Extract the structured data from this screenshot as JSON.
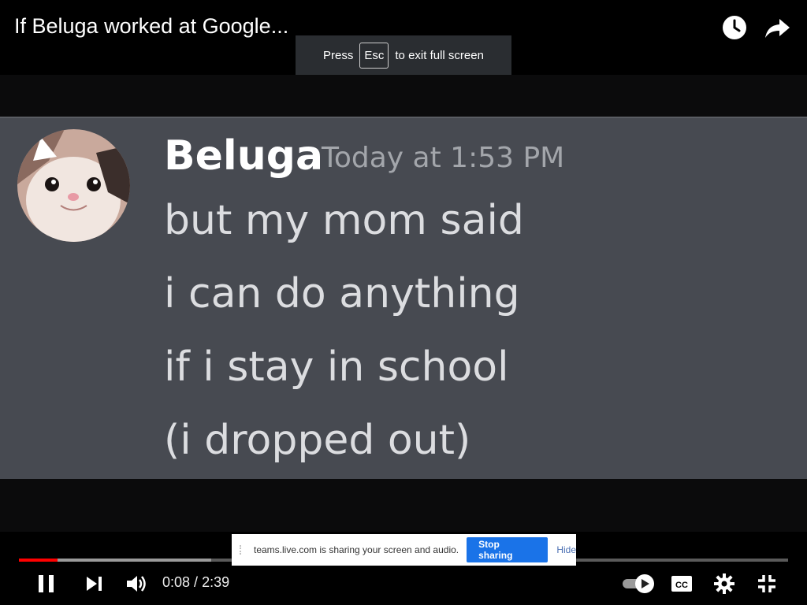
{
  "player": {
    "title": "If Beluga worked at Google...",
    "fullscreen_hint": {
      "before": "Press",
      "key": "Esc",
      "after": "to exit full screen"
    },
    "top_icons": [
      "watch-later-icon",
      "share-icon"
    ],
    "progress": {
      "played_fraction": 0.05,
      "buffered_fraction": 0.25
    },
    "time": {
      "current": "0:08",
      "separator": " / ",
      "duration": "2:39"
    },
    "controls": [
      "pause-icon",
      "next-icon",
      "volume-icon",
      "autoplay-toggle",
      "captions-icon",
      "settings-icon",
      "exit-fullscreen-icon"
    ],
    "colors": {
      "played": "#ff0000",
      "message_bg": "#474a51"
    }
  },
  "message": {
    "author": "Beluga",
    "timestamp": "Today at 1:53 PM",
    "lines": [
      "but my mom said",
      "i can do anything",
      "if i stay in school",
      "(i dropped out)"
    ]
  },
  "share_bar": {
    "text": "teams.live.com is sharing your screen and audio.",
    "stop_label": "Stop sharing",
    "hide_label": "Hide"
  }
}
